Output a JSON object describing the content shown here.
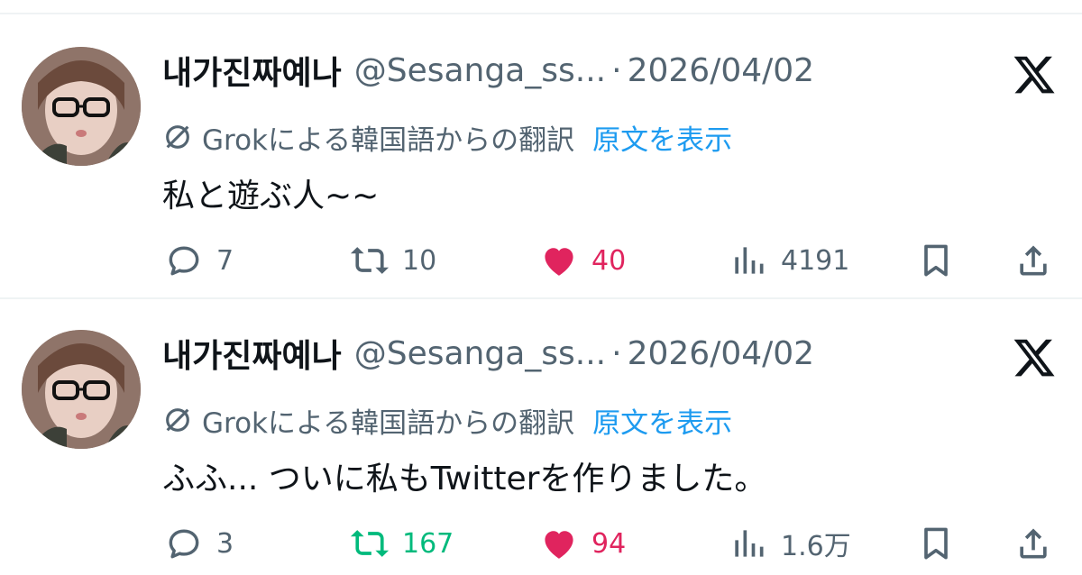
{
  "tweets": [
    {
      "display_name": "내가진짜예나",
      "handle": "@Sesanga_ss...",
      "separator": "·",
      "date": "2026/04/02",
      "translation_label": "Grokによる韓国語からの翻訳",
      "show_original": "原文を表示",
      "text": "私と遊ぶ人~~",
      "replies": "7",
      "retweets": "10",
      "likes": "40",
      "views": "4191",
      "retweeted": false,
      "liked": true
    },
    {
      "display_name": "내가진짜예나",
      "handle": "@Sesanga_ss...",
      "separator": "·",
      "date": "2026/04/02",
      "translation_label": "Grokによる韓国語からの翻訳",
      "show_original": "原文を表示",
      "text": "ふふ... ついに私もTwitterを作りました。",
      "replies": "3",
      "retweets": "167",
      "likes": "94",
      "views": "1.6万",
      "retweeted": true,
      "liked": true
    }
  ],
  "colors": {
    "text": "#0f1419",
    "secondary": "#536471",
    "link": "#1d9bf0",
    "like": "#e0245e",
    "retweet": "#00ba7c",
    "divider": "#eff3f4"
  },
  "icons": [
    "reply-icon",
    "retweet-icon",
    "heart-icon",
    "views-icon",
    "bookmark-icon",
    "share-icon",
    "x-logo-icon",
    "translate-icon"
  ]
}
